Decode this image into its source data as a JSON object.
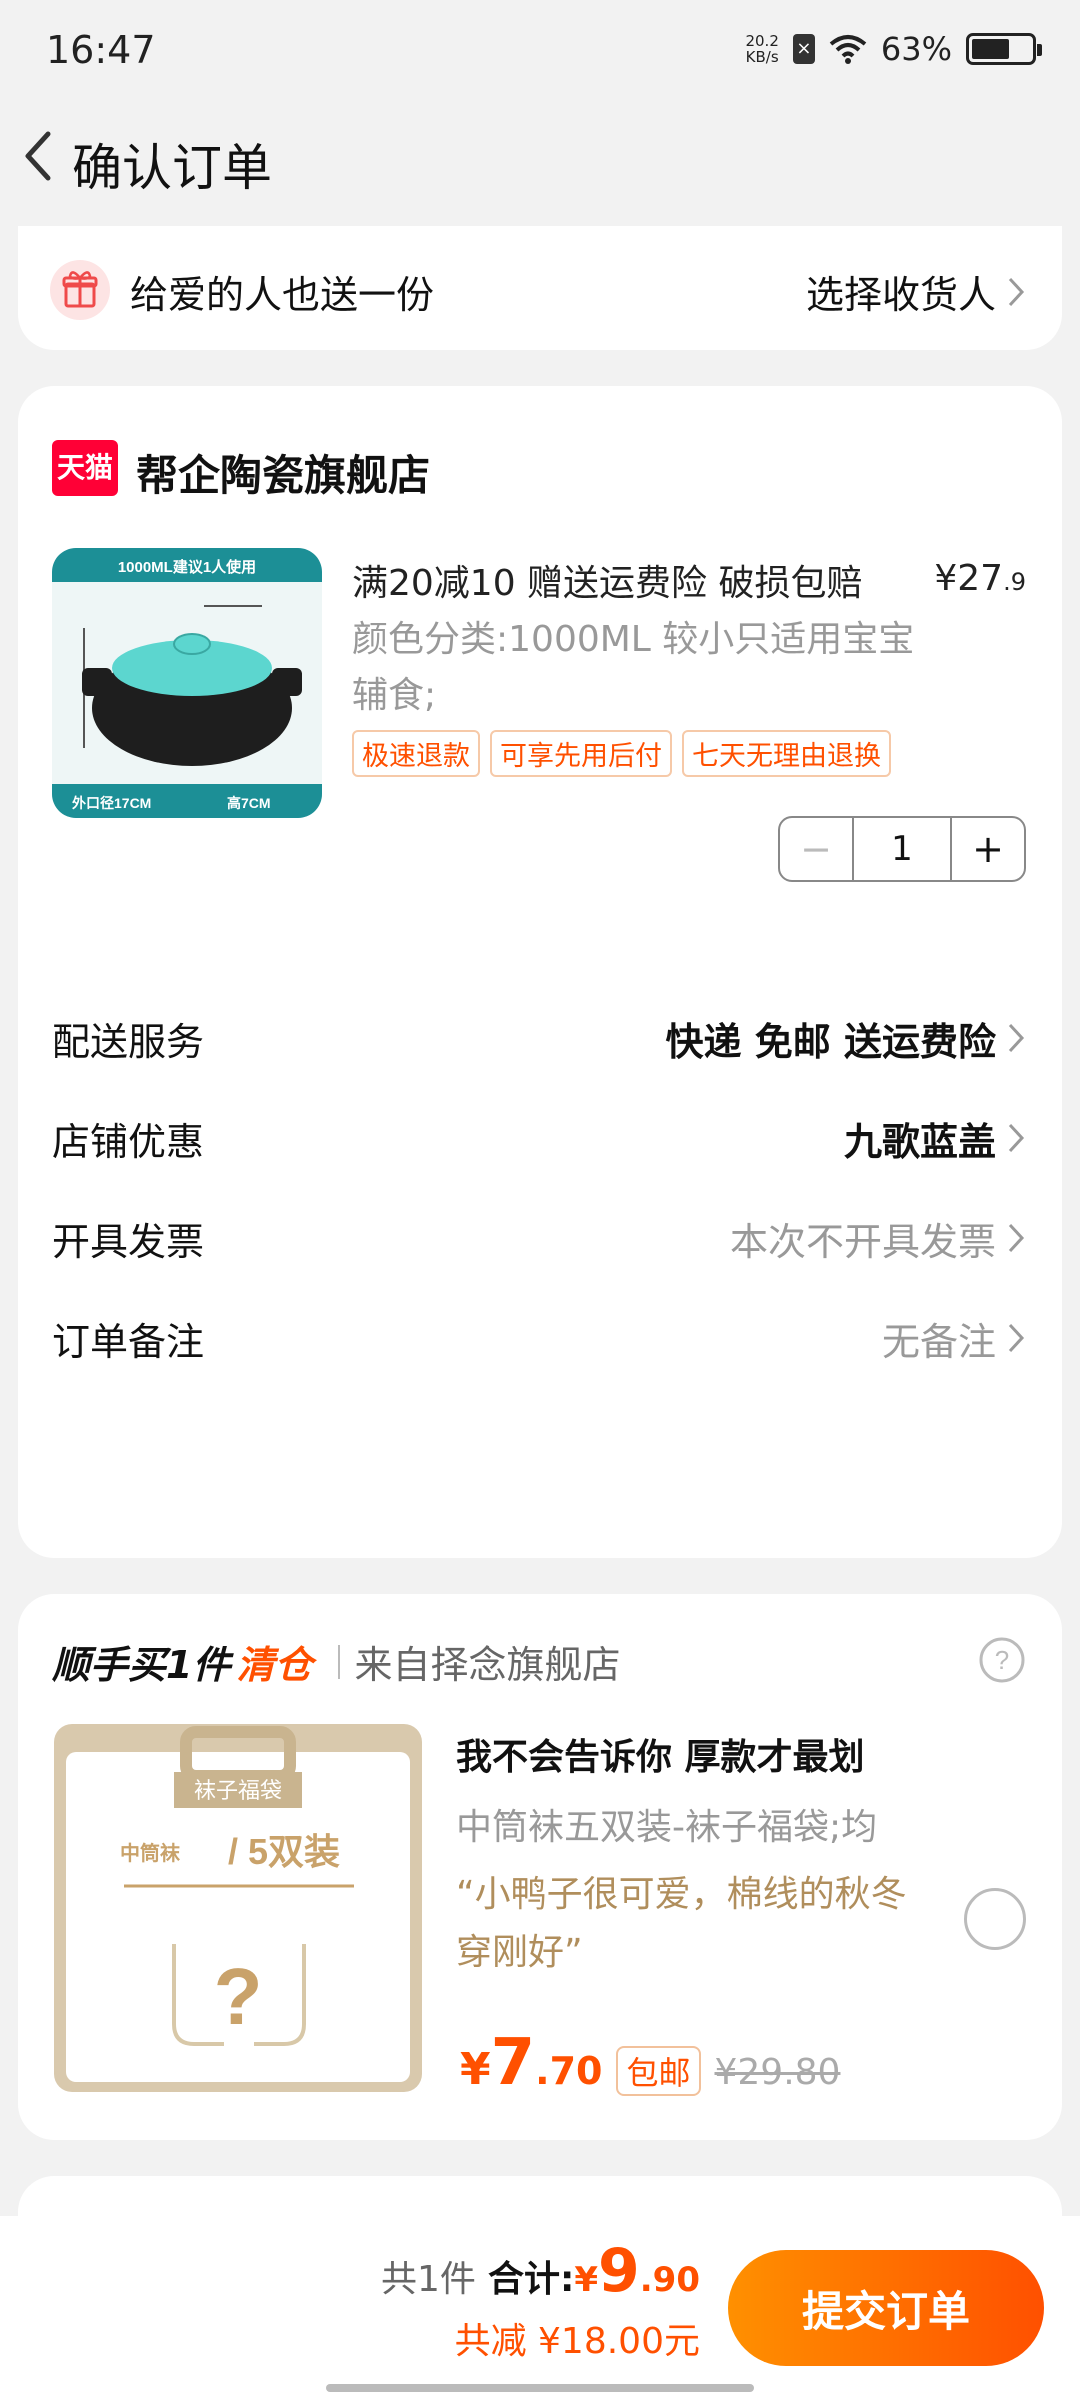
{
  "status": {
    "time": "16:47",
    "net_speed_value": "20.2",
    "net_speed_unit": "KB/s",
    "battery_text": "63%",
    "battery_level": 0.63
  },
  "nav": {
    "title": "确认订单"
  },
  "gift": {
    "label": "给爱的人也送一份",
    "action": "选择收货人"
  },
  "store": {
    "badge": "天猫",
    "name": "帮企陶瓷旗舰店",
    "product": {
      "title": "满20减10 赠送运费险 破损包赔",
      "price_symbol": "¥",
      "price_int": "27",
      "price_dec": ".9",
      "spec": "颜色分类:1000ML 较小只适用宝宝辅食;",
      "tags": [
        "极速退款",
        "可享先用后付",
        "七天无理由退换"
      ],
      "image_texts": {
        "top": "1000ML建议1人使用",
        "bottom_left": "外口径17CM",
        "bottom_right": "高7CM"
      }
    },
    "quantity": {
      "minus": "−",
      "value": "1",
      "plus": "+"
    },
    "rows": [
      {
        "label": "配送服务",
        "value": "快递 免邮 送运费险"
      },
      {
        "label": "店铺优惠",
        "value": "九歌蓝盖"
      },
      {
        "label": "开具发票",
        "value": "本次不开具发票"
      },
      {
        "label": "订单备注",
        "value": "无备注"
      }
    ]
  },
  "addon": {
    "heading_a": "顺手买1件",
    "heading_b": "清仓",
    "source": "来自择念旗舰店",
    "help": "?",
    "title": "我不会告诉你 厚款才最划",
    "spec": "中筒袜五双装-袜子福袋;均",
    "quote": "“小鸭子很可爱，棉线的秋冬穿刚好”",
    "price_symbol": "¥",
    "price_int": "7",
    "price_dec": ".70",
    "badge": "包邮",
    "original_price": "¥29.80",
    "image_texts": {
      "title": "袜子福袋",
      "subtitle": "中筒袜",
      "pack": "/ 5双装",
      "mark": "?"
    }
  },
  "footer": {
    "count": "共1件",
    "total_label": "合计:",
    "total_symbol": "¥",
    "total_int": "9",
    "total_dec": ".90",
    "discount": "共减 ¥18.00元",
    "submit": "提交订单"
  },
  "colors": {
    "accent": "#ff5000",
    "tmall_red": "#ff0036",
    "quote": "#b08e5c"
  }
}
